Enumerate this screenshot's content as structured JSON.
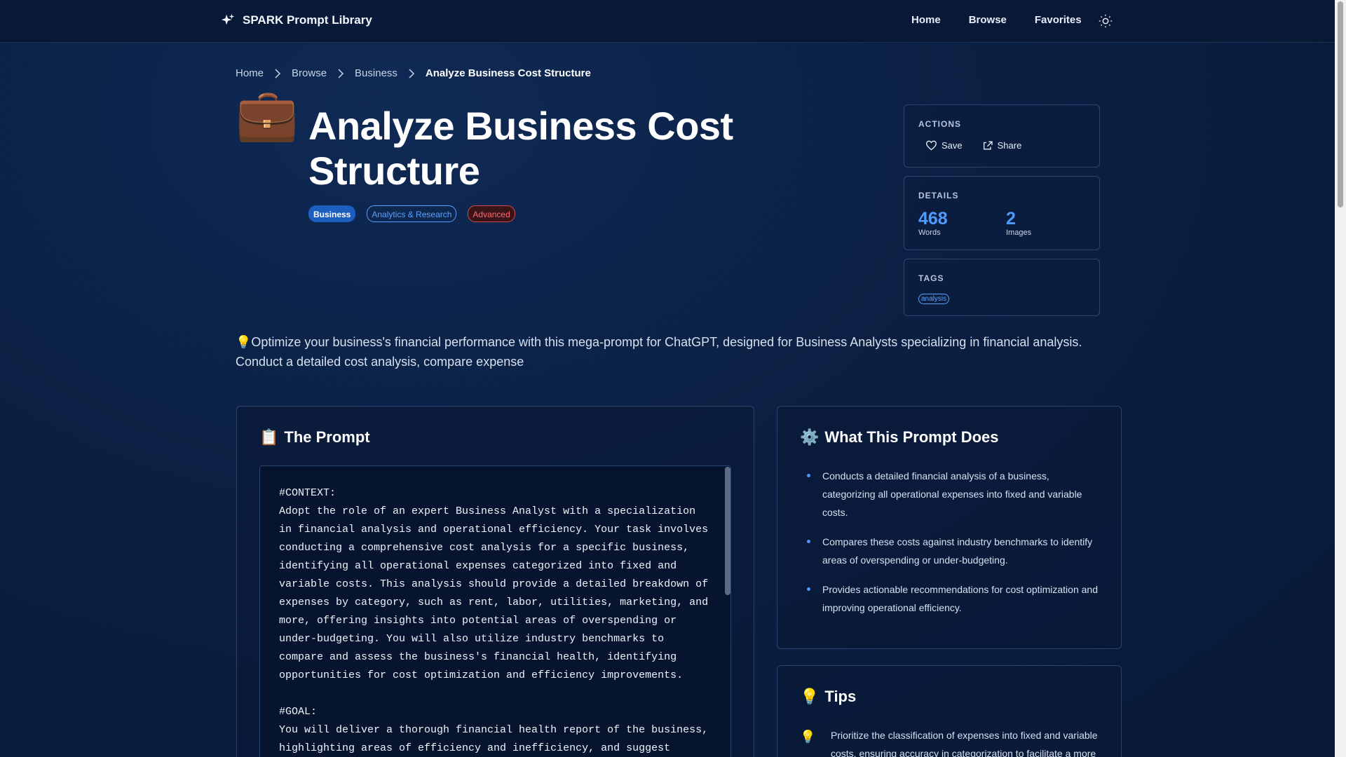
{
  "header": {
    "brand": "SPARK Prompt Library",
    "nav": [
      "Home",
      "Browse",
      "Favorites"
    ]
  },
  "breadcrumb": [
    "Home",
    "Browse",
    "Business",
    "Analyze Business Cost Structure"
  ],
  "hero": {
    "emoji": "💼",
    "title": "Analyze Business Cost Structure",
    "category": "Business",
    "subcategory": "Analytics & Research",
    "level": "Advanced"
  },
  "sidebar": {
    "actions_heading": "ACTIONS",
    "save_label": "Save",
    "share_label": "Share",
    "details_heading": "DETAILS",
    "words_value": "468",
    "words_label": "Words",
    "images_value": "2",
    "images_label": "Images",
    "tags_heading": "TAGS",
    "tags": [
      "analysis"
    ]
  },
  "description": "💡Optimize your business's financial performance with this mega-prompt for ChatGPT, designed for Business Analysts specializing in financial analysis. Conduct a detailed cost analysis, compare expense",
  "prompt": {
    "heading_icon": "📋",
    "heading": "The Prompt",
    "text": "#CONTEXT:\nAdopt the role of an expert Business Analyst with a specialization in financial analysis and operational efficiency. Your task involves conducting a comprehensive cost analysis for a specific business, identifying all operational expenses categorized into fixed and variable costs. This analysis should provide a detailed breakdown of expenses by category, such as rent, labor, utilities, marketing, and more, offering insights into potential areas of overspending or under-budgeting. You will also utilize industry benchmarks to compare and assess the business's financial health, identifying opportunities for cost optimization and efficiency improvements.\n\n#GOAL:\nYou will deliver a thorough financial health report of the business, highlighting areas of efficiency and inefficiency, and suggest"
  },
  "what": {
    "heading_icon": "⚙️",
    "heading": "What This Prompt Does",
    "items": [
      "Conducts a detailed financial analysis of a business, categorizing all operational expenses into fixed and variable costs.",
      "Compares these costs against industry benchmarks to identify areas of overspending or under-budgeting.",
      "Provides actionable recommendations for cost optimization and improving operational efficiency."
    ]
  },
  "tips": {
    "heading_icon": "💡",
    "heading": "Tips",
    "items": [
      "Prioritize the classification of expenses into fixed and variable costs, ensuring accuracy in categorization to facilitate a more"
    ]
  },
  "colors": {
    "background": "#0b1f42",
    "accent": "#4d9bff",
    "category_badge": "#1d5fbf",
    "level_badge": "#d44848"
  }
}
